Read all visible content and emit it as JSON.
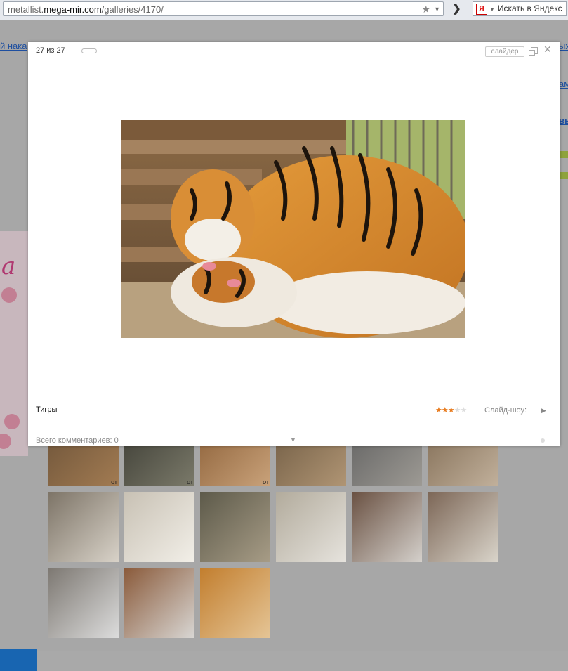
{
  "browser": {
    "url_prefix": "metallist.",
    "url_host": "mega-mir.com",
    "url_path": "/galleries/4170/",
    "search_placeholder": "Искать в Яндекс",
    "search_logo": "Я"
  },
  "background_page": {
    "left_link_text": "й нака",
    "right_link_text": "ых",
    "right_link_2": "ам",
    "right_link_3": "вь",
    "decor_letter": "a",
    "thumb_overlay_text": "от"
  },
  "gallery": {
    "thumbnails": [
      {
        "name": "thumb-1",
        "colors": [
          "#6b5238",
          "#a27b52"
        ],
        "overlay": true
      },
      {
        "name": "thumb-2",
        "colors": [
          "#3b3b33",
          "#7b7a6a"
        ],
        "overlay": true
      },
      {
        "name": "thumb-3",
        "colors": [
          "#8a5e36",
          "#c9a27a"
        ],
        "overlay": true
      },
      {
        "name": "thumb-4",
        "colors": [
          "#6e5a42",
          "#b09574"
        ],
        "overlay": false
      },
      {
        "name": "thumb-5",
        "colors": [
          "#5f5f5f",
          "#9d9a94"
        ],
        "overlay": false
      },
      {
        "name": "thumb-6",
        "colors": [
          "#7f6a52",
          "#c1b09b"
        ],
        "overlay": false
      },
      {
        "name": "thumb-7",
        "colors": [
          "#7d7467",
          "#d8d2c8"
        ],
        "overlay": false
      },
      {
        "name": "thumb-8",
        "colors": [
          "#c8c1b4",
          "#f2efe8"
        ],
        "overlay": false
      },
      {
        "name": "thumb-9",
        "colors": [
          "#5d5a4a",
          "#a79c86"
        ],
        "overlay": false
      },
      {
        "name": "thumb-10",
        "colors": [
          "#b2ab9c",
          "#e6e3dd"
        ],
        "overlay": false
      },
      {
        "name": "thumb-11",
        "colors": [
          "#6a5142",
          "#d4d0cb"
        ],
        "overlay": false
      },
      {
        "name": "thumb-12",
        "colors": [
          "#7c6656",
          "#d9d4ca"
        ],
        "overlay": false
      },
      {
        "name": "thumb-13",
        "colors": [
          "#7d7872",
          "#dcdcdc"
        ],
        "overlay": false
      },
      {
        "name": "thumb-14",
        "colors": [
          "#8a5a3a",
          "#d8d6d3"
        ],
        "overlay": false
      },
      {
        "name": "thumb-15",
        "colors": [
          "#c27e2e",
          "#e5c596"
        ],
        "overlay": false
      }
    ]
  },
  "modal": {
    "counter": "27 из 27",
    "progress_fraction": 1.0,
    "slider_label": "слайдер",
    "caption": "Тигры",
    "rating": 3,
    "rating_max": 5,
    "slideshow_label": "Слайд-шоу:",
    "comments_label": "Всего комментариев: 0"
  }
}
